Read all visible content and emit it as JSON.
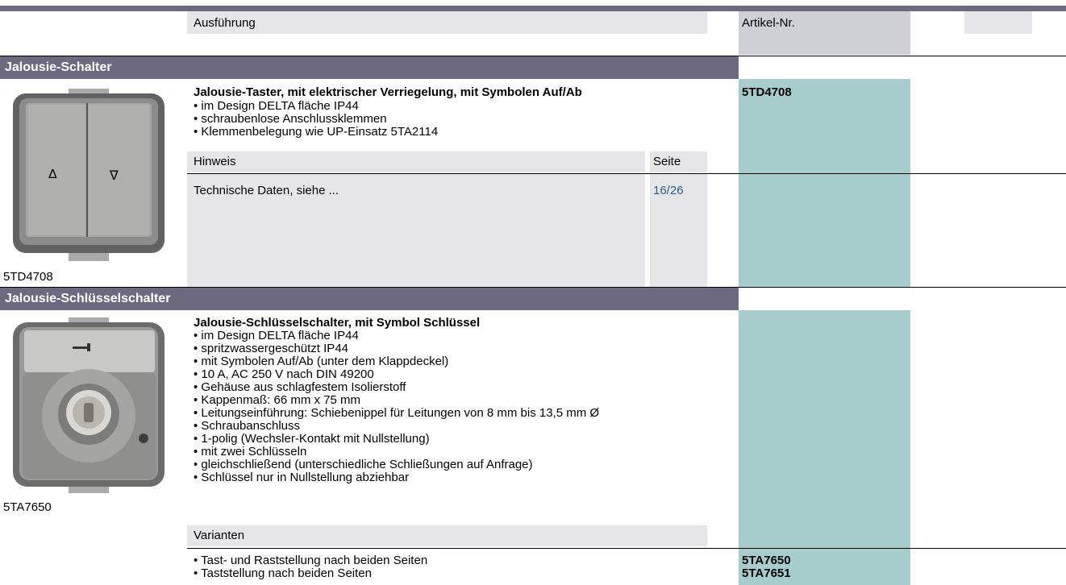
{
  "header": {
    "ausfuehrung": "Ausführung",
    "artikel_nr": "Artikel-Nr."
  },
  "section1": {
    "title": "Jalousie-Schalter",
    "product_caption": "5TD4708",
    "heading": "Jalousie-Taster, mit elektrischer Verriegelung, mit Symbolen Auf/Ab",
    "bullets": [
      "• im Design DELTA fläche IP44",
      "• schraubenlose Anschlussklemmen",
      "• Klemmenbelegung wie UP-Einsatz 5TA2114"
    ],
    "article": "5TD4708",
    "hinweis_label": "Hinweis",
    "seite_label": "Seite",
    "hinweis_text": "Technische Daten, siehe ...",
    "seite_ref": "16/26"
  },
  "section2": {
    "title": "Jalousie-Schlüsselschalter",
    "product_caption": "5TA7650",
    "heading": "Jalousie-Schlüsselschalter, mit Symbol Schlüssel",
    "bullets": [
      "• im Design DELTA fläche IP44",
      "• spritzwassergeschützt IP44",
      "• mit Symbolen Auf/Ab (unter dem Klappdeckel)",
      "• 10 A, AC 250 V nach DIN 49200",
      "• Gehäuse aus schlagfestem Isolierstoff",
      "• Kappenmaß: 66 mm x 75 mm",
      "• Leitungseinführung: Schiebenippel für Leitungen von 8 mm bis 13,5 mm Ø",
      "• Schraubanschluss",
      "• 1-polig (Wechsler-Kontakt mit Nullstellung)",
      "• mit zwei Schlüsseln",
      "• gleichschließend (unterschiedliche Schließungen auf Anfrage)",
      "• Schlüssel nur in Nullstellung abziehbar"
    ],
    "varianten_label": "Varianten",
    "variants": [
      {
        "text": "• Tast- und Raststellung nach beiden Seiten",
        "article": "5TA7650"
      },
      {
        "text": "• Taststellung nach beiden Seiten",
        "article": "5TA7651"
      }
    ]
  },
  "images": {
    "switch_symbols": [
      "Δ",
      "∇"
    ]
  },
  "colors": {
    "section_bar": "#6d6a7f",
    "article_column": "#a6cccc",
    "light_grey": "#e6e6e9",
    "link": "#2a5e86"
  }
}
